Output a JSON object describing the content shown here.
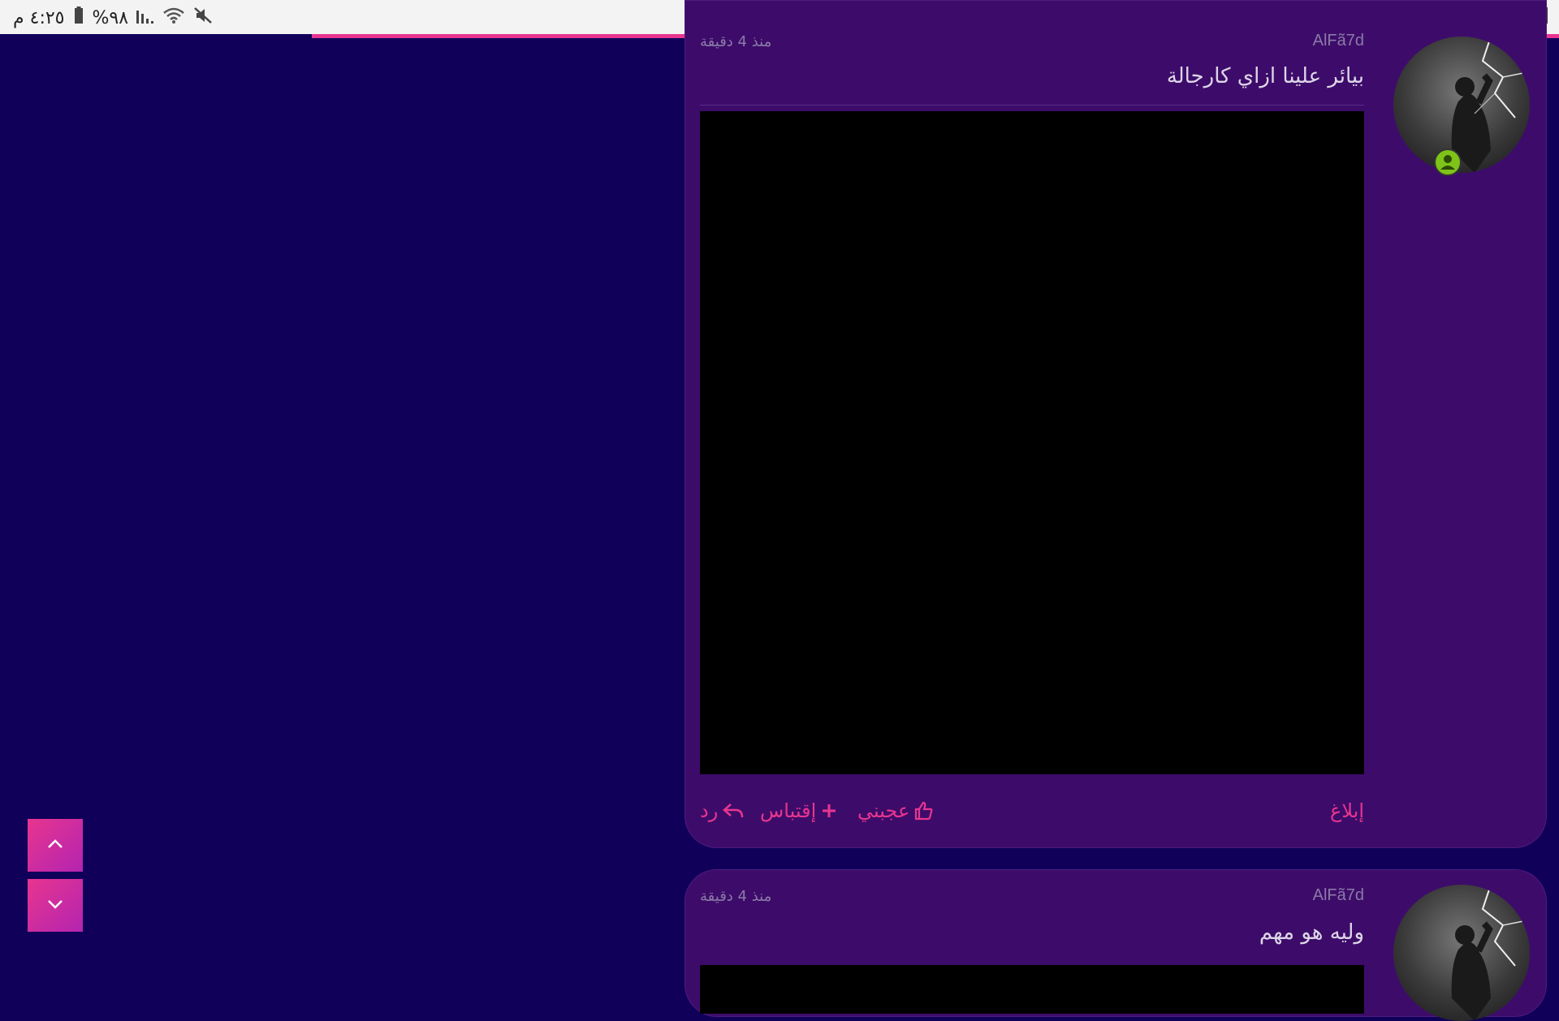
{
  "status_bar": {
    "time": "٤:٢٥ م",
    "battery": "%٩٨",
    "icons": [
      "battery-icon",
      "signal-icon",
      "wifi-icon",
      "mute-icon",
      "image-icon"
    ]
  },
  "posts": [
    {
      "username": "AlFã7d",
      "timestamp": "منذ 4 دقيقة",
      "text": "بيائر علينا ازاي كارجالة",
      "actions": {
        "report": "إبلاغ",
        "like": "عجبني",
        "quote": "إقتباس",
        "reply": "رد"
      }
    },
    {
      "username": "AlFã7d",
      "timestamp": "منذ 4 دقيقة",
      "text": "وليه هو مهم"
    }
  ],
  "colors": {
    "background": "#10005a",
    "post": "#3d0c6a",
    "accent": "#e8358f",
    "online": "#7ec318"
  }
}
